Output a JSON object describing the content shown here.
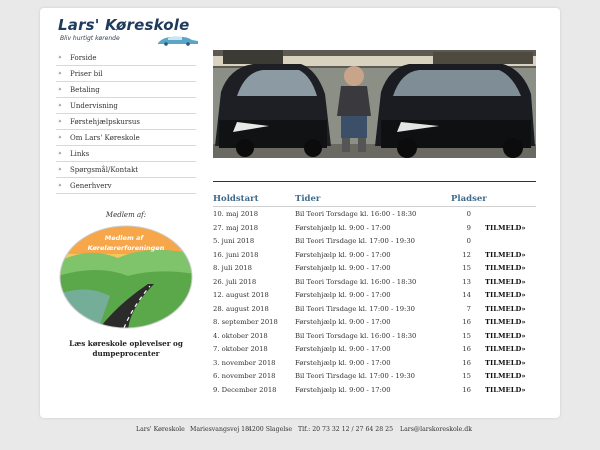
{
  "logo": {
    "title": "Lars' Køreskole",
    "tagline": "Bliv hurtigt kørende"
  },
  "nav": {
    "items": [
      {
        "label": "Forside"
      },
      {
        "label": "Priser bil"
      },
      {
        "label": "Betaling"
      },
      {
        "label": "Undervisning"
      },
      {
        "label": "Førstehjælpskursus"
      },
      {
        "label": "Om Lars' Køreskole"
      },
      {
        "label": "Links"
      },
      {
        "label": "Spørgsmål/Kontakt"
      },
      {
        "label": "Generhverv"
      }
    ]
  },
  "sidebar": {
    "member_label": "Medlem af:",
    "badge_text_1": "Medlem af",
    "badge_text_2": "Kørelærerforeningen",
    "caption": "Læs køreskole oplevelser og dumpeprocenter"
  },
  "schedule": {
    "headers": {
      "date": "Holdstart",
      "time": "Tider",
      "places": "Pladser"
    },
    "rows": [
      {
        "date": "10. maj 2018",
        "time": "Bil Teori Torsdage kl. 16:00 - 18:30",
        "places": "0",
        "signup": ""
      },
      {
        "date": "27. maj 2018",
        "time": "Førstehjælp kl. 9:00 - 17:00",
        "places": "9",
        "signup": "TILMELD»"
      },
      {
        "date": "5. juni 2018",
        "time": "Bil Teori Tirsdage kl. 17:00 - 19:30",
        "places": "0",
        "signup": ""
      },
      {
        "date": "16. juni 2018",
        "time": "Førstehjælp kl. 9:00 - 17:00",
        "places": "12",
        "signup": "TILMELD»"
      },
      {
        "date": "8. juli 2018",
        "time": "Førstehjælp kl. 9:00 - 17:00",
        "places": "15",
        "signup": "TILMELD»"
      },
      {
        "date": "26. juli 2018",
        "time": "Bil Teori Torsdage kl. 16:00 - 18:30",
        "places": "13",
        "signup": "TILMELD»"
      },
      {
        "date": "12. august 2018",
        "time": "Førstehjælp kl. 9:00 - 17:00",
        "places": "14",
        "signup": "TILMELD»"
      },
      {
        "date": "28. august 2018",
        "time": "Bil Teori Tirsdage kl. 17:00 - 19:30",
        "places": "7",
        "signup": "TILMELD»"
      },
      {
        "date": "8. september 2018",
        "time": "Førstehjælp kl. 9:00 - 17:00",
        "places": "16",
        "signup": "TILMELD»"
      },
      {
        "date": "4. oktober 2018",
        "time": "Bil Teori Torsdage kl. 16:00 - 18:30",
        "places": "15",
        "signup": "TILMELD»"
      },
      {
        "date": "7. oktober 2018",
        "time": "Førstehjælp kl. 9:00 - 17:00",
        "places": "16",
        "signup": "TILMELD»"
      },
      {
        "date": "3. november 2018",
        "time": "Førstehjælp kl. 9:00 - 17:00",
        "places": "16",
        "signup": "TILMELD»"
      },
      {
        "date": "6. november 2018",
        "time": "Bil Teori Tirsdage kl. 17:00 - 19:30",
        "places": "15",
        "signup": "TILMELD»"
      },
      {
        "date": "9. December 2018",
        "time": "Førstehjælp kl. 9:00 - 17:00",
        "places": "16",
        "signup": "TILMELD»"
      }
    ]
  },
  "footer": {
    "name": "Lars' Køreskole",
    "address": "Mariesvangsvej 18",
    "city": "4200 Slagelse",
    "phone": "Tlf.: 20 73 32 12 / 27 64 28 25",
    "email": "Lars@larskoreskole.dk"
  },
  "colors": {
    "accent": "#3d6a8a",
    "logo_text": "#1f3a5c",
    "page_bg": "#e9e9e9"
  }
}
